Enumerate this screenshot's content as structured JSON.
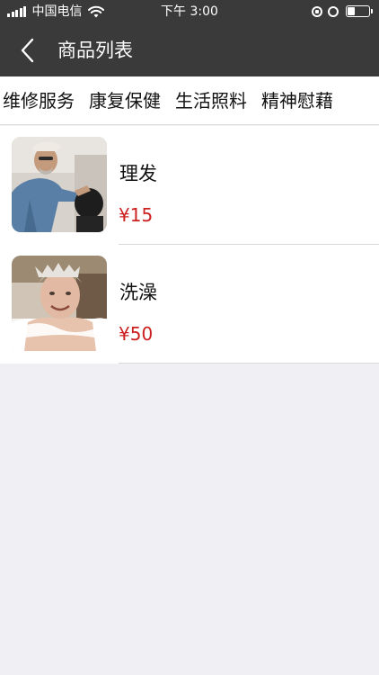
{
  "status_bar": {
    "carrier": "中国电信",
    "time": "下午 3:00",
    "battery_level": 0.3
  },
  "nav": {
    "title": "商品列表",
    "back_icon": "chevron-left-icon"
  },
  "tabs": [
    {
      "label": "维修服务"
    },
    {
      "label": "康复保健"
    },
    {
      "label": "生活照料"
    },
    {
      "label": "精神慰藉"
    }
  ],
  "products": [
    {
      "name": "理发",
      "price": "¥15",
      "image": "haircut-photo"
    },
    {
      "name": "洗澡",
      "price": "¥50",
      "image": "bath-photo"
    }
  ],
  "colors": {
    "bar_bg": "#3a3a3a",
    "price": "#cc1f1f",
    "page_bg": "#efeff4"
  }
}
